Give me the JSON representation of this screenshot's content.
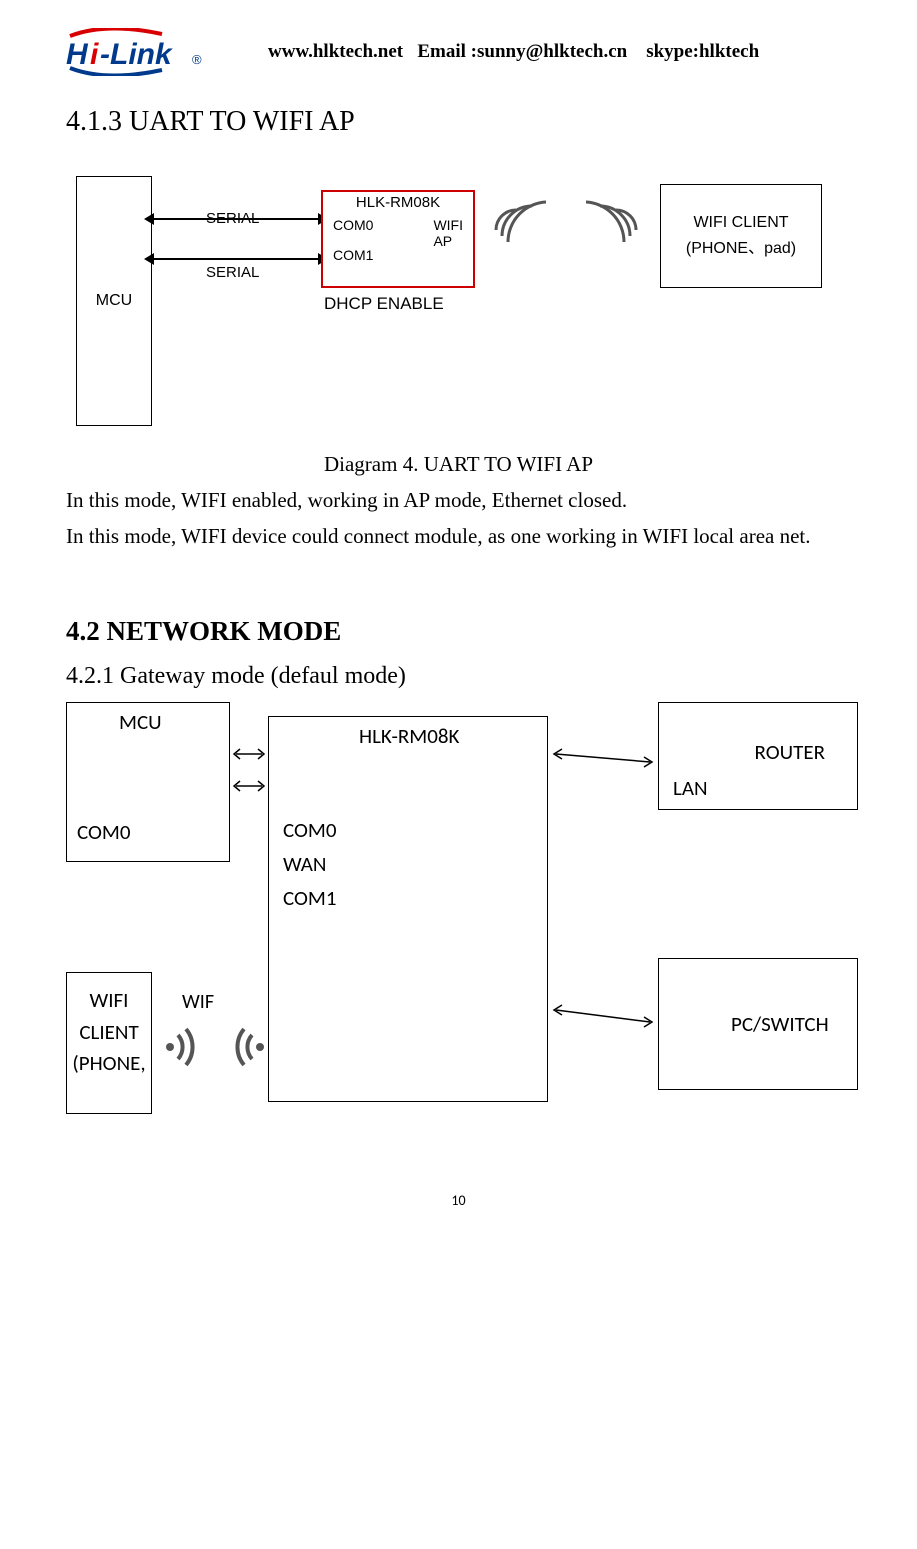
{
  "header": {
    "logo_text": "Hi-Link",
    "website": "www.hlktech.net",
    "email_label": "Email :sunny@hlktech.cn",
    "skype": "skype:hlktech"
  },
  "section413": {
    "heading": "4.1.3    UART TO WIFI AP",
    "diagram": {
      "mcu": "MCU",
      "serial1": "SERIAL",
      "serial2": "SERIAL",
      "hlk_title": "HLK-RM08K",
      "hlk_com0": "COM0",
      "hlk_wifi_ap_1": "WIFI",
      "hlk_wifi_ap_2": "AP",
      "hlk_com1": "COM1",
      "dhcp": "DHCP ENABLE",
      "client_line1": "WIFI CLIENT",
      "client_line2": "(PHONE、pad)"
    },
    "caption": "Diagram 4. UART TO WIFI AP",
    "body_line1": "In this mode, WIFI enabled, working in AP mode, Ethernet closed.",
    "body_line2": "In this mode, WIFI device could connect module, as one working in WIFI local area net."
  },
  "section42": {
    "heading": "4.2 NETWORK MODE",
    "sub_heading": "4.2.1 Gateway mode (defaul mode)",
    "diagram": {
      "mcu_title": "MCU",
      "mcu_com0": "COM0",
      "hlk_title": "HLK-RM08K",
      "hlk_com0": "COM0",
      "hlk_wan": "WAN",
      "hlk_com1": "COM1",
      "router_title": "ROUTER",
      "router_lan": "LAN",
      "pcswitch": "PC/SWITCH",
      "wifi_label": "WIF",
      "wifi_client_1": "WIFI",
      "wifi_client_2": "CLIENT",
      "wifi_client_3": "(PHONE,"
    }
  },
  "page_number": "10"
}
